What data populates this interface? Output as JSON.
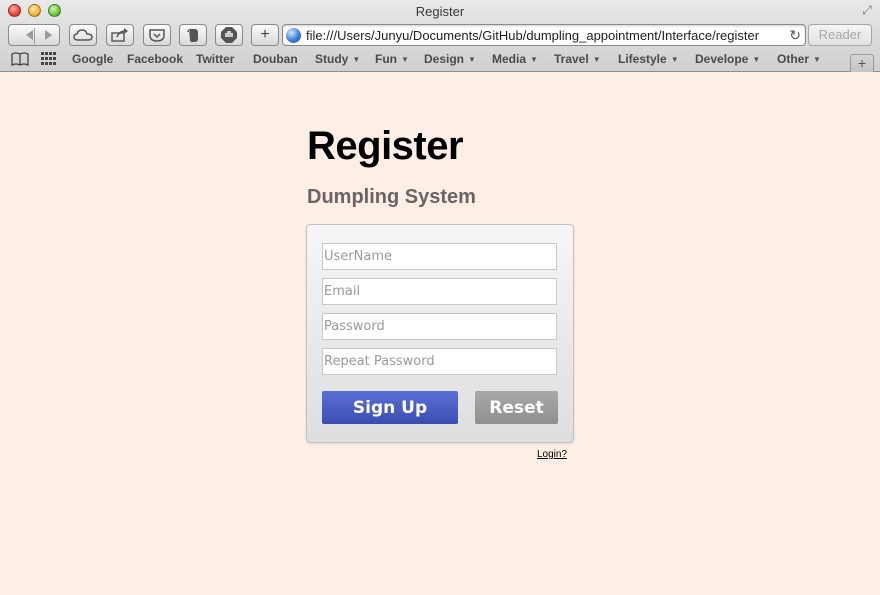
{
  "window": {
    "title": "Register"
  },
  "toolbar": {
    "url": "file:///Users/Junyu/Documents/GitHub/dumpling_appointment/Interface/register",
    "reader_label": "Reader",
    "new_tab_label": "+"
  },
  "bookmarks": {
    "items": [
      {
        "label": "Google",
        "menu": false
      },
      {
        "label": "Facebook",
        "menu": false
      },
      {
        "label": "Twitter",
        "menu": false
      },
      {
        "label": "Douban",
        "menu": false
      },
      {
        "label": "Study",
        "menu": true
      },
      {
        "label": "Fun",
        "menu": true
      },
      {
        "label": "Design",
        "menu": true
      },
      {
        "label": "Media",
        "menu": true
      },
      {
        "label": "Travel",
        "menu": true
      },
      {
        "label": "Lifestyle",
        "menu": true
      },
      {
        "label": "Develope",
        "menu": true
      },
      {
        "label": "Other",
        "menu": true
      }
    ]
  },
  "page": {
    "title": "Register",
    "subtitle": "Dumpling System",
    "form": {
      "username_placeholder": "UserName",
      "email_placeholder": "Email",
      "password_placeholder": "Password",
      "repeat_password_placeholder": "Repeat Password",
      "signup_label": "Sign Up",
      "reset_label": "Reset"
    },
    "login_link": "Login?"
  },
  "colors": {
    "page_background": "#fdeee6",
    "signup_button": "#4b5ec6",
    "reset_button": "#9b9b9b",
    "subtitle": "#6a6464"
  },
  "icons": [
    "close-icon",
    "minimize-icon",
    "zoom-icon",
    "fullscreen-icon",
    "back-icon",
    "forward-icon",
    "icloud-icon",
    "share-icon",
    "pocket-icon",
    "evernote-icon",
    "adblock-icon",
    "add-icon",
    "globe-icon",
    "reload-icon",
    "book-icon",
    "grid-icon",
    "plus-icon"
  ]
}
